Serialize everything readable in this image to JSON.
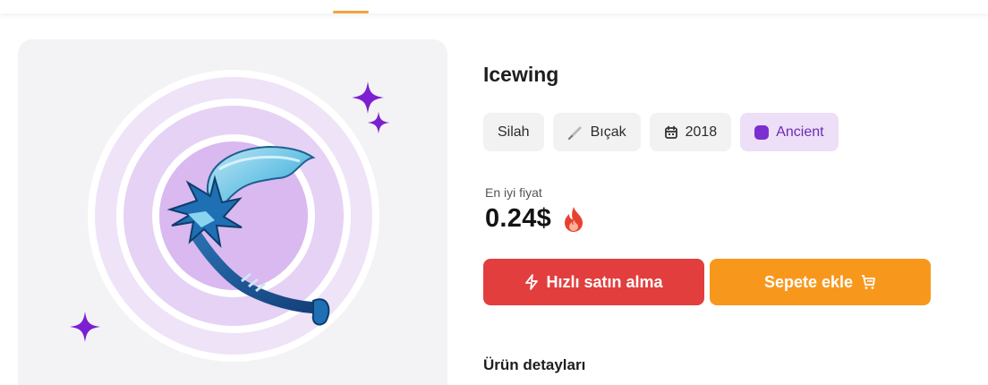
{
  "product": {
    "title": "Icewing",
    "tags": [
      {
        "label": "Silah",
        "icon": null
      },
      {
        "label": "Bıçak",
        "icon": "knife-icon"
      },
      {
        "label": "2018",
        "icon": "calendar-icon"
      },
      {
        "label": "Ancient",
        "icon": "rarity-dot-icon",
        "color": "#7b2fd0"
      }
    ],
    "price_label": "En iyi fiyat",
    "price": "0.24$",
    "price_icon": "fire-icon"
  },
  "actions": {
    "buy_now": "Hızlı satın alma",
    "add_to_cart": "Sepete ekle"
  },
  "sections": {
    "details_title": "Ürün detayları"
  },
  "colors": {
    "accent_tab": "#f5a23a",
    "buy_button": "#e23e3e",
    "cart_button": "#f7981d",
    "rarity": "#7b2fd0"
  }
}
